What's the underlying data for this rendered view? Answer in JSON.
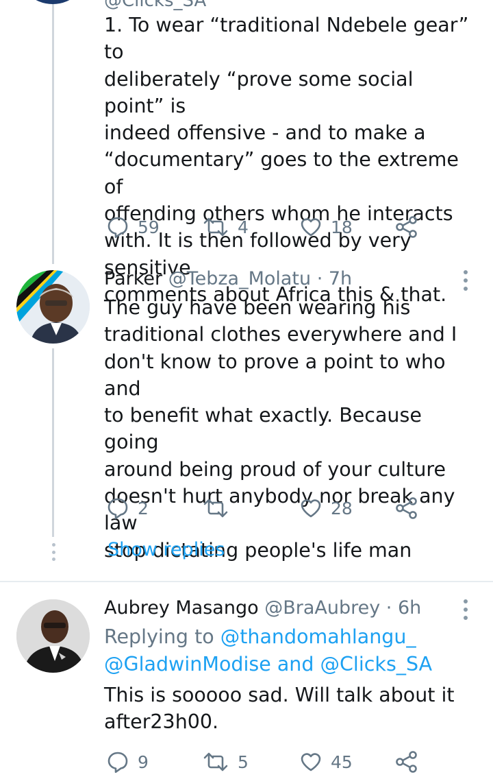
{
  "tweet1": {
    "handle_partial": "@Clicks_SA",
    "text_lines": [
      "1. To wear “traditional Ndebele gear” to",
      "deliberately “prove some social point” is",
      "indeed offensive - and to make a",
      "“documentary” goes to the extreme of",
      "offending others whom he interacts",
      "with. It is then followed by very sensitive",
      "comments about Africa this & that."
    ],
    "replies": "59",
    "retweets": "4",
    "likes": "18"
  },
  "tweet2": {
    "name": "Parker",
    "meta": "@Tebza_Molatu · 7h",
    "text_lines": [
      "The guy have been wearing his",
      "traditional clothes everywhere and I",
      "don't know to prove a point to who and",
      "to benefit what exactly. Because going",
      "around being proud of your culture",
      "doesn't hurt anybody nor break any law",
      "stop dictating people's life man"
    ],
    "replies": "2",
    "retweets": "",
    "likes": "28",
    "show_replies": "Show replies"
  },
  "tweet3": {
    "name": "Aubrey Masango",
    "meta": "@BraAubrey · 6h",
    "replying_prefix": "Replying to ",
    "replying_to_1": "@thandomahlangu_",
    "replying_to_2": "@GladwinModise",
    "replying_and": " and ",
    "replying_to_3": "@Clicks_SA",
    "text_lines": [
      "This is sooooo sad. Will talk about it",
      "after23h00."
    ],
    "replies": "9",
    "retweets": "5",
    "likes": "45"
  },
  "colors": {
    "text": "#14171a",
    "secondary": "#657786",
    "link": "#1da1f2",
    "thread_line": "#d0d6dc"
  },
  "icons": [
    "reply-icon",
    "retweet-icon",
    "like-icon",
    "share-icon",
    "more-options-icon"
  ]
}
